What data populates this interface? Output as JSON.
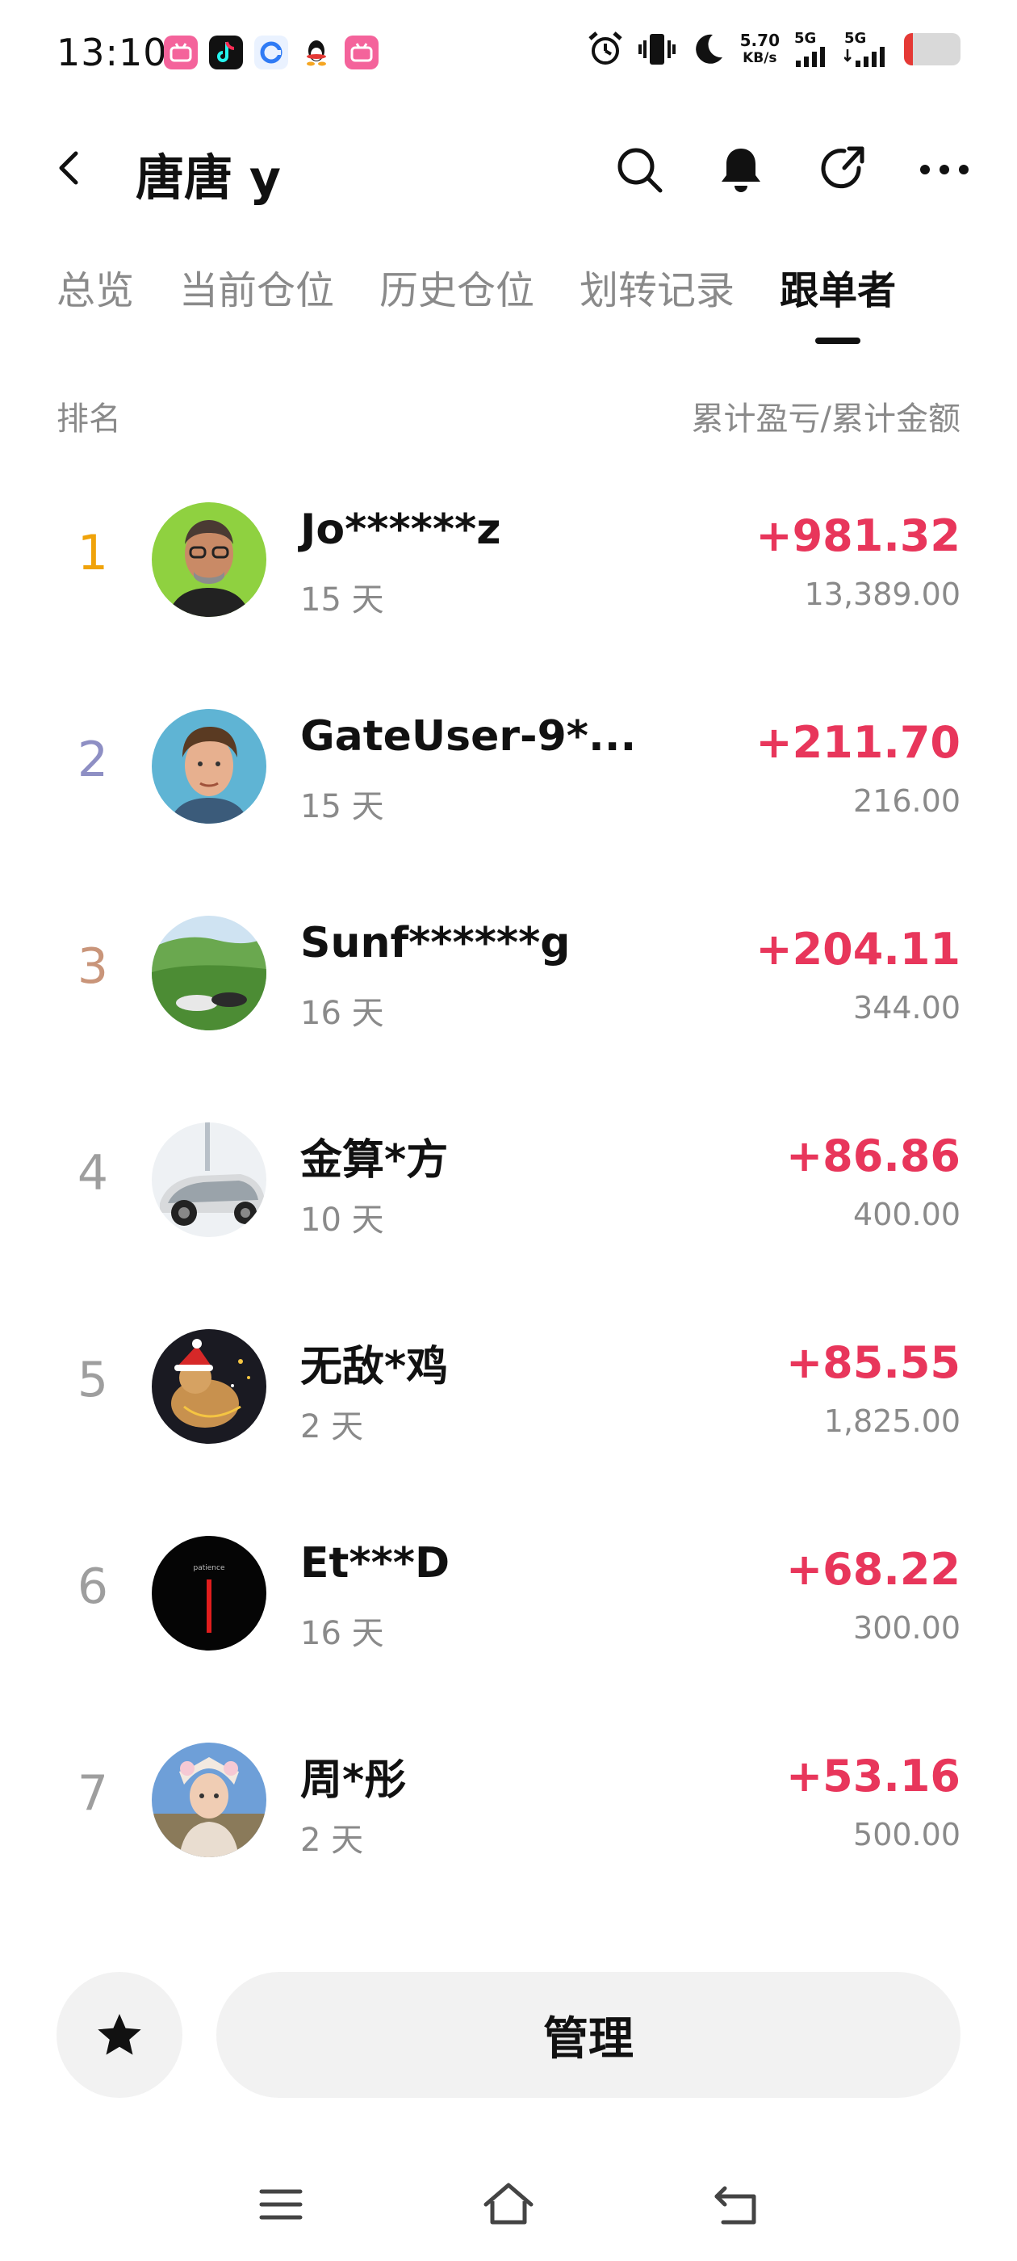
{
  "status_bar": {
    "time": "13:10",
    "apps": [
      {
        "icon": "bilibili-icon",
        "color": "#f4639b"
      },
      {
        "icon": "tiktok-icon",
        "color": "#111111"
      },
      {
        "icon": "browser-icon",
        "color": "#2f7bf5"
      },
      {
        "icon": "qq-icon",
        "color": "#ffffff"
      },
      {
        "icon": "bilibili-icon",
        "color": "#f4639b"
      }
    ],
    "net_speed_value": "5.70",
    "net_speed_unit": "KB/s",
    "signal_1_label": "5G",
    "signal_2_label": "5G",
    "battery_level": 0.15
  },
  "header": {
    "title": "唐唐 y",
    "icons": [
      "search-icon",
      "bell-icon",
      "share-icon",
      "more-icon"
    ]
  },
  "tabs": [
    {
      "label": "总览",
      "active": false
    },
    {
      "label": "当前仓位",
      "active": false
    },
    {
      "label": "历史仓位",
      "active": false
    },
    {
      "label": "划转记录",
      "active": false
    },
    {
      "label": "跟单者",
      "active": true
    }
  ],
  "list_header": {
    "left": "排名",
    "right": "累计盈亏/累计金额"
  },
  "followers": [
    {
      "rank": "1",
      "rank_color": "#f0a30a",
      "name": "Jo******z",
      "days": "15 天",
      "pnl": "+981.32",
      "amount": "13,389.00"
    },
    {
      "rank": "2",
      "rank_color": "#8e8fc4",
      "name": "GateUser-9*...",
      "days": "15 天",
      "pnl": "+211.70",
      "amount": "216.00"
    },
    {
      "rank": "3",
      "rank_color": "#c9957a",
      "name": "Sunf******g",
      "days": "16 天",
      "pnl": "+204.11",
      "amount": "344.00"
    },
    {
      "rank": "4",
      "rank_color": "#9e9e9e",
      "name": "金算*方",
      "days": "10 天",
      "pnl": "+86.86",
      "amount": "400.00"
    },
    {
      "rank": "5",
      "rank_color": "#9e9e9e",
      "name": "无敌*鸡",
      "days": "2 天",
      "pnl": "+85.55",
      "amount": "1,825.00"
    },
    {
      "rank": "6",
      "rank_color": "#9e9e9e",
      "name": "Et***D",
      "days": "16 天",
      "pnl": "+68.22",
      "amount": "300.00"
    },
    {
      "rank": "7",
      "rank_color": "#9e9e9e",
      "name": "周*彤",
      "days": "2 天",
      "pnl": "+53.16",
      "amount": "500.00"
    }
  ],
  "avatar_6_text": "patience",
  "bottom": {
    "manage_label": "管理",
    "fav_icon": "star-icon"
  },
  "system_nav": [
    "menu-icon",
    "home-icon",
    "back-nav-icon"
  ],
  "colors": {
    "profit": "#e8365b",
    "muted": "#8a8a8a",
    "button_bg": "#f2f2f2"
  }
}
